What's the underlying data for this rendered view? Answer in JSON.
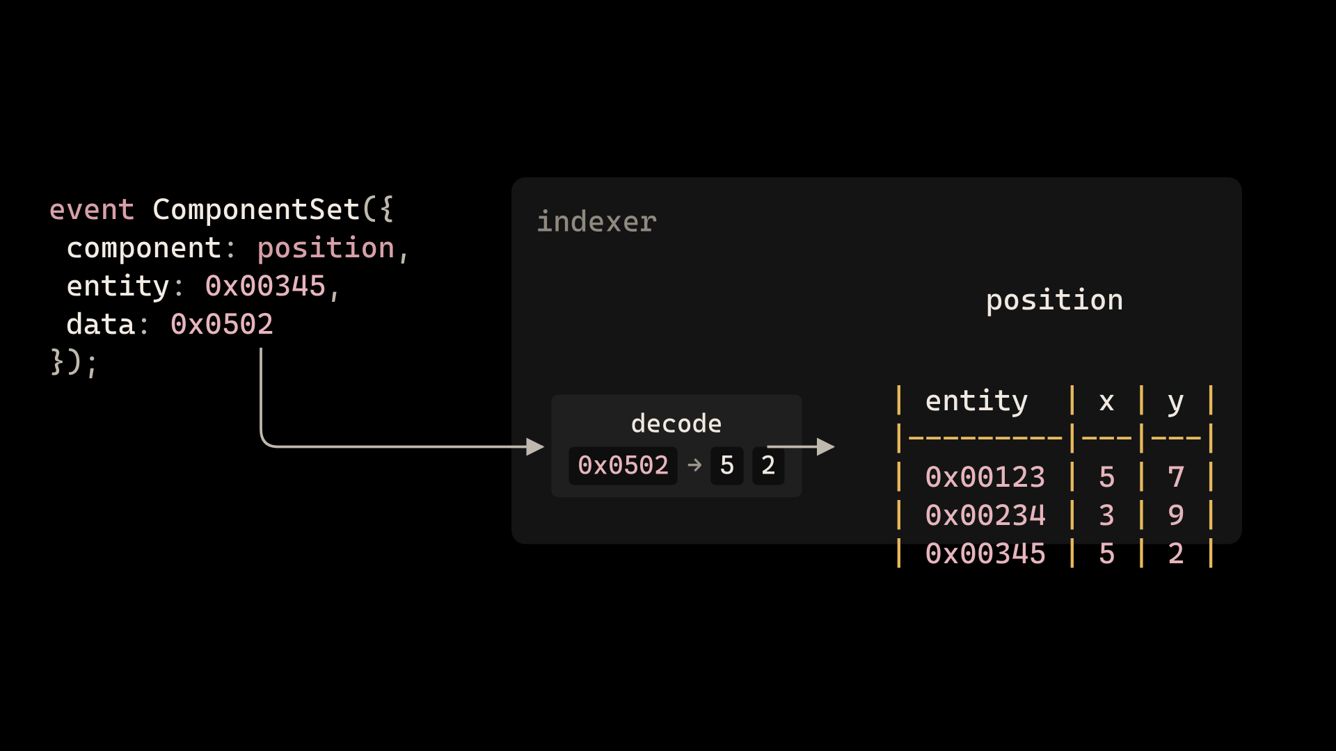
{
  "code": {
    "event_kw": "event",
    "fn_name": "ComponentSet",
    "open": "({",
    "l1_key": "component",
    "l1_val": "position",
    "l2_key": "entity",
    "l2_val": "0x00345",
    "l3_key": "data",
    "l3_val": "0x0502",
    "close": "});"
  },
  "panel": {
    "title": "indexer",
    "table_title": "position"
  },
  "table": {
    "headers": {
      "entity": "entity",
      "x": "x",
      "y": "y"
    },
    "rows": [
      {
        "entity": "0x00123",
        "x": "5",
        "y": "7"
      },
      {
        "entity": "0x00234",
        "x": "3",
        "y": "9"
      },
      {
        "entity": "0x00345",
        "x": "5",
        "y": "2"
      }
    ]
  },
  "decode": {
    "title": "decode",
    "raw": "0x0502",
    "arrow": "→",
    "out1": "5",
    "out2": "2"
  }
}
